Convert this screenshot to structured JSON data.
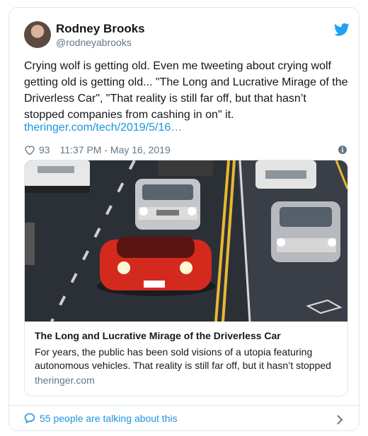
{
  "tweet": {
    "author_name": "Rodney Brooks",
    "author_handle": "@rodneyabrooks",
    "text": "Crying wolf is getting old. Even me tweeting about crying wolf\ngetting old is getting old... \"The Long and Lucrative Mirage of the\nDriverless Car\", \"That reality is still far off, but that hasn’t\nstopped companies from cashing in on\" it.",
    "link_text": "theringer.com/tech/2019/5/16…",
    "likes": "93",
    "timestamp": "11:37 PM - May 16, 2019"
  },
  "card": {
    "title": "The Long and Lucrative Mirage of the Driverless Car",
    "description": "For years, the public has been sold visions of a utopia featuring autonomous vehicles. That reality is still far off, but it hasn’t stopped",
    "domain": "theringer.com"
  },
  "footer": {
    "conversation_text": "55 people are talking about this"
  },
  "icons": [
    "twitter-bird-icon",
    "heart-icon",
    "info-icon",
    "comment-icon",
    "chevron-right-icon"
  ],
  "colors": {
    "twitter_blue": "#1da1f2",
    "link_blue": "#1b95e0",
    "secondary_text": "#657786",
    "border": "#e1e8ed"
  }
}
